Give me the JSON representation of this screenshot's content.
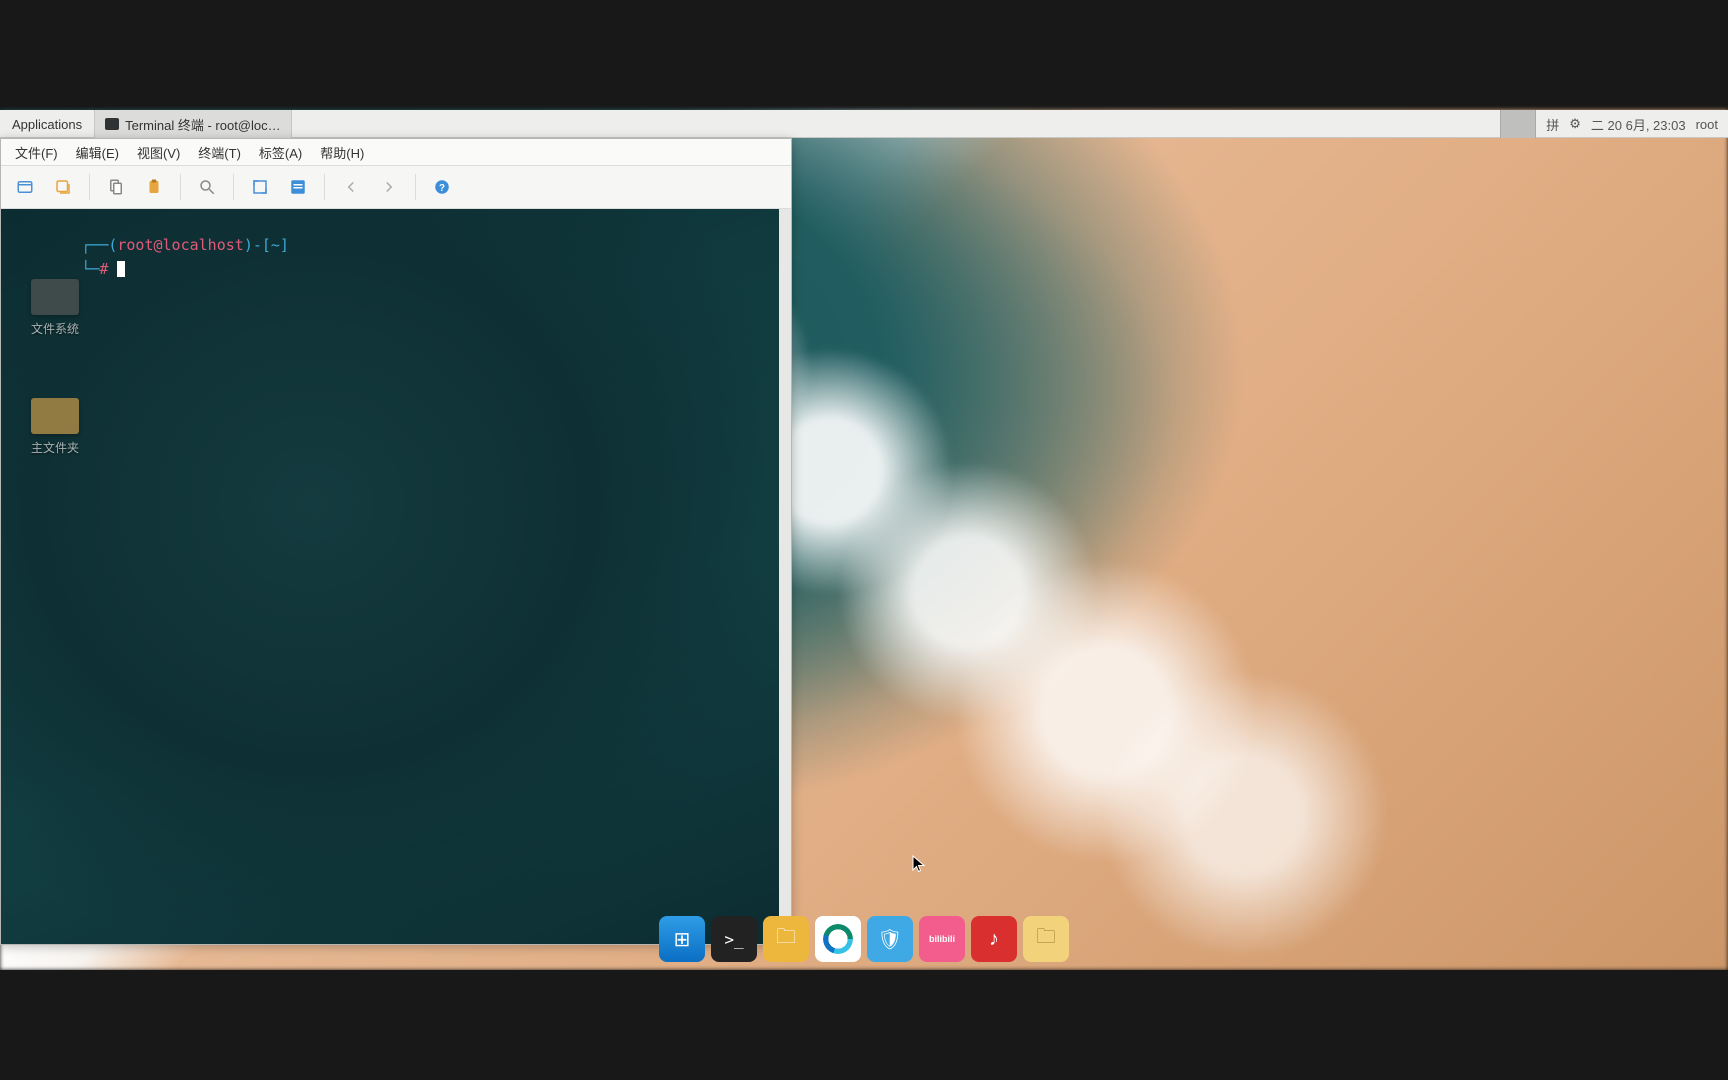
{
  "panel": {
    "applications_label": "Applications",
    "task_title": "Terminal 终端 - root@loc…",
    "tray": {
      "input_method": "拼",
      "control_icon": "⚙",
      "clock": "二 20 6月, 23:03",
      "user": "root"
    }
  },
  "terminal": {
    "menubar": [
      "文件(F)",
      "编辑(E)",
      "视图(V)",
      "终端(T)",
      "标签(A)",
      "帮助(H)"
    ],
    "prompt": {
      "open": "┌──(",
      "user_host": "root@localhost",
      "close": ")-[~]",
      "line2_prefix": "└─",
      "line2_symbol": "#"
    },
    "desktop_icons": [
      "文件系统",
      "主文件夹"
    ]
  },
  "dock": {
    "items": [
      {
        "name": "start",
        "glyph": "⊞"
      },
      {
        "name": "terminal",
        "glyph": ">_"
      },
      {
        "name": "files",
        "glyph": "🗀"
      },
      {
        "name": "edge",
        "glyph": ""
      },
      {
        "name": "safe",
        "glyph": "🛡"
      },
      {
        "name": "bilibili",
        "glyph": "bilibili"
      },
      {
        "name": "netease-music",
        "glyph": "♪"
      },
      {
        "name": "folder",
        "glyph": "🗀"
      }
    ]
  }
}
